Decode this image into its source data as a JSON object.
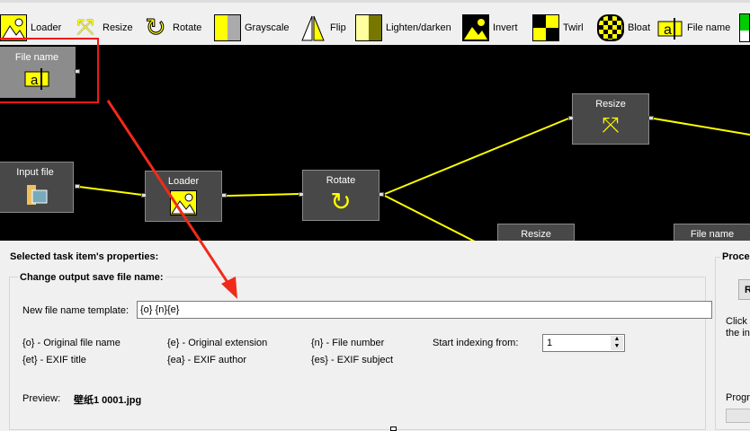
{
  "toolbar": {
    "items": [
      {
        "label": "Loader",
        "icon": "loader-icon"
      },
      {
        "label": "Resize",
        "icon": "resize-icon"
      },
      {
        "label": "Rotate",
        "icon": "rotate-icon"
      },
      {
        "label": "Grayscale",
        "icon": "grayscale-icon"
      },
      {
        "label": "Flip",
        "icon": "flip-icon"
      },
      {
        "label": "Lighten/darken",
        "icon": "lighten-darken-icon"
      },
      {
        "label": "Invert",
        "icon": "invert-icon"
      },
      {
        "label": "Twirl",
        "icon": "twirl-icon"
      },
      {
        "label": "Bloat",
        "icon": "bloat-icon"
      },
      {
        "label": "File name",
        "icon": "file-name-icon"
      }
    ]
  },
  "nodes": {
    "file_name": "File name",
    "input_file": "Input file",
    "loader": "Loader",
    "rotate": "Rotate",
    "resize1": "Resize",
    "resize2": "Resize",
    "file_name2": "File name"
  },
  "properties": {
    "title": "Selected task item's properties:",
    "group": "Change output save file name:",
    "template_label": "New file name template:",
    "template_value": "{o} {n}{e}",
    "tokens": [
      "{o} - Original file name",
      "{e} - Original extension",
      "{n} - File number",
      "{et} - EXIF title",
      "{ea} - EXIF author",
      "{es} - EXIF subject"
    ],
    "start_label": "Start indexing from:",
    "start_value": "1",
    "preview_label": "Preview:",
    "preview_value": "壁纸1 0001.jpg"
  },
  "process": {
    "title": "Proce",
    "button": "R",
    "hint1": "Click 'l",
    "hint2": "the in",
    "progress_label": "Progr"
  },
  "colors": {
    "accent": "#ffff00",
    "highlight": "#ff2020"
  }
}
